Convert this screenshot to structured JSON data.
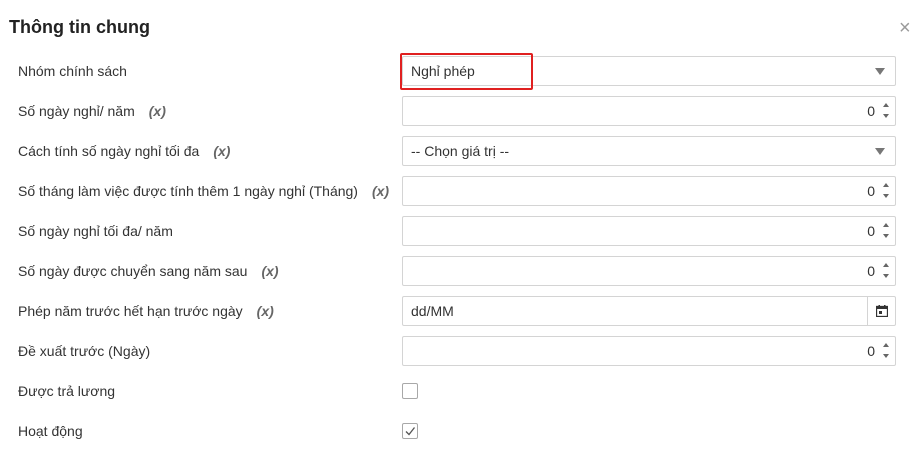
{
  "dialog": {
    "title": "Thông tin chung",
    "close_glyph": "×"
  },
  "fields": {
    "policy_group": {
      "label": "Nhóm chính sách",
      "value": "Nghỉ phép"
    },
    "days_per_year": {
      "label": "Số ngày nghỉ/ năm",
      "formula": "(x)",
      "value": "0"
    },
    "max_days_method": {
      "label": "Cách tính số ngày nghỉ tối đa",
      "formula": "(x)",
      "value": "-- Chọn giá trị --"
    },
    "months_per_extra_day": {
      "label": "Số tháng làm việc được tính thêm 1 ngày nghỉ (Tháng)",
      "formula": "(x)",
      "value": "0"
    },
    "max_days_per_year": {
      "label": "Số ngày nghỉ tối đa/ năm",
      "value": "0"
    },
    "carry_over_days": {
      "label": "Số ngày được chuyển sang năm sau",
      "formula": "(x)",
      "value": "0"
    },
    "prev_year_expiry": {
      "label": "Phép năm trước hết hạn trước ngày",
      "formula": "(x)",
      "value": "dd/MM"
    },
    "propose_before_days": {
      "label": "Đề xuất trước (Ngày)",
      "value": "0"
    },
    "paid": {
      "label": "Được trả lương",
      "checked": false
    },
    "active": {
      "label": "Hoạt động",
      "checked": true
    }
  },
  "icons": {
    "close": "close-icon",
    "dropdown": "chevron-down-icon",
    "spinner": "spinner-arrows-icon",
    "calendar": "calendar-icon",
    "check": "checkmark-icon"
  },
  "colors": {
    "highlight_border": "#e02020",
    "input_border": "#d4d4d4"
  }
}
